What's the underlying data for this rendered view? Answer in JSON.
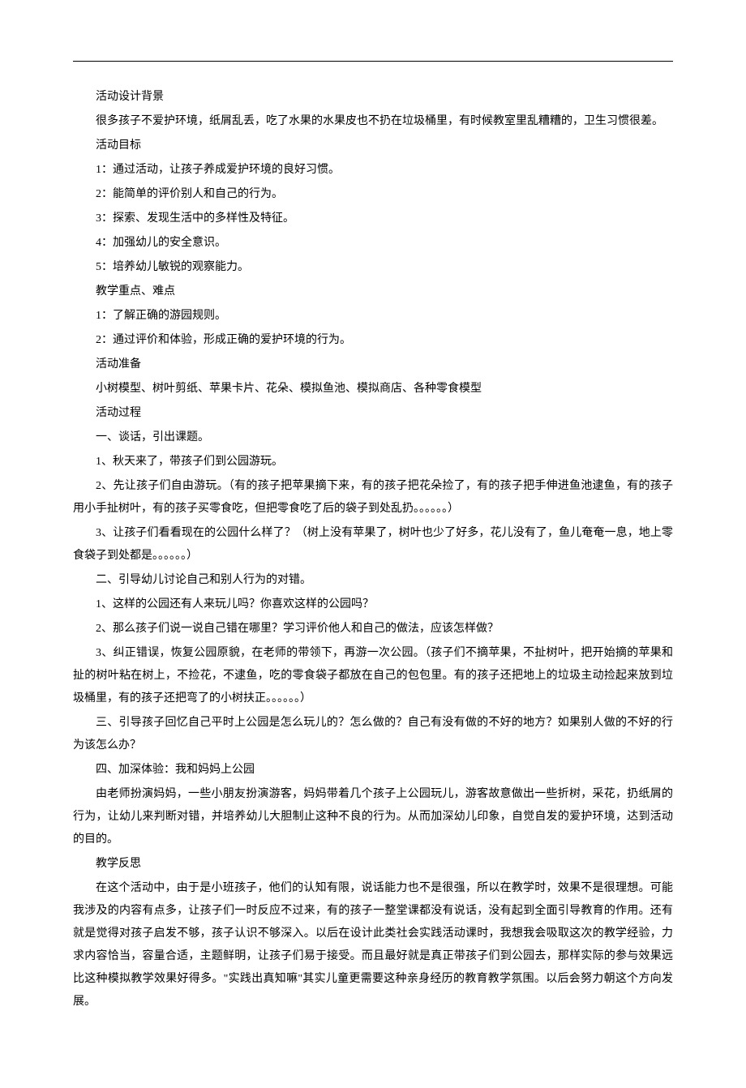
{
  "sections": {
    "s1_title": "活动设计背景",
    "s1_p1": "很多孩子不爱护环境，纸屑乱丢，吃了水果的水果皮也不扔在垃圾桶里，有时候教室里乱糟糟的，卫生习惯很差。",
    "s2_title": "活动目标",
    "s2_i1": "1：通过活动，让孩子养成爱护环境的良好习惯。",
    "s2_i2": "2：能简单的评价别人和自己的行为。",
    "s2_i3": "3：探索、发现生活中的多样性及特征。",
    "s2_i4": "4：加强幼儿的安全意识。",
    "s2_i5": "5：培养幼儿敏锐的观察能力。",
    "s3_title": "教学重点、难点",
    "s3_i1": "1：了解正确的游园规则。",
    "s3_i2": "2：通过评价和体验，形成正确的爱护环境的行为。",
    "s4_title": "活动准备",
    "s4_p1": "小树模型、树叶剪纸、苹果卡片、花朵、模拟鱼池、模拟商店、各种零食模型",
    "s5_title": "活动过程",
    "s5_h1": "一、谈话，引出课题。",
    "s5_h1_i1": "1、秋天来了，带孩子们到公园游玩。",
    "s5_h1_i2": "2、先让孩子们自由游玩。（有的孩子把苹果摘下来，有的孩子把花朵捡了，有的孩子把手伸进鱼池逮鱼，有的孩子用小手扯树叶，有的孩子买零食吃，但把零食吃了后的袋子到处乱扔。。。。。。）",
    "s5_h1_i3": "3、让孩子们看看现在的公园什么样了？（树上没有苹果了，树叶也少了好多，花儿没有了，鱼儿奄奄一息，地上零食袋子到处都是。。。。。。）",
    "s5_h2": "二、引导幼儿讨论自己和别人行为的对错。",
    "s5_h2_i1": "1、这样的公园还有人来玩儿吗？你喜欢这样的公园吗？",
    "s5_h2_i2": "2、那么孩子们说一说自己错在哪里？学习评价他人和自己的做法，应该怎样做？",
    "s5_h2_i3": "3、纠正错误，恢复公园原貌，在老师的带领下，再游一次公园。（孩子们不摘苹果，不扯树叶，把开始摘的苹果和扯的树叶粘在树上，不捡花，不逮鱼，吃的零食袋子都放在自己的包包里。有的孩子还把地上的垃圾主动捡起来放到垃圾桶里，有的孩子还把弯了的小树扶正。。。。。。）",
    "s5_h3": "三、引导孩子回忆自己平时上公园是怎么玩儿的？怎么做的？自己有没有做的不好的地方？如果别人做的不好的行为该怎么办？",
    "s5_h4": "四、加深体验：我和妈妈上公园",
    "s5_h4_p1": "由老师扮演妈妈，一些小朋友扮演游客，妈妈带着几个孩子上公园玩儿，游客故意做出一些折树，采花，扔纸屑的行为，让幼儿来判断对错，并培养幼儿大胆制止这种不良的行为。从而加深幼儿印象，自觉自发的爱护环境，达到活动的目的。",
    "s6_title": "教学反思",
    "s6_p1": "在这个活动中，由于是小班孩子，他们的认知有限，说话能力也不是很强，所以在教学时，效果不是很理想。可能我涉及的内容有点多，让孩子们一时反应不过来，有的孩子一整堂课都没有说话，没有起到全面引导教育的作用。还有就是觉得对孩子启发不够，孩子认识不够深入。以后在设计此类社会实践活动课时，我想我会吸取这次的教学经验，力求内容恰当，容量合适，主题鲜明，让孩子们易于接受。而且最好就是真正带孩子们到公园去，那样实际的参与效果远比这种模拟教学效果好得多。\"实践出真知嘛\"其实儿童更需要这种亲身经历的教育教学氛围。以后会努力朝这个方向发展。"
  }
}
